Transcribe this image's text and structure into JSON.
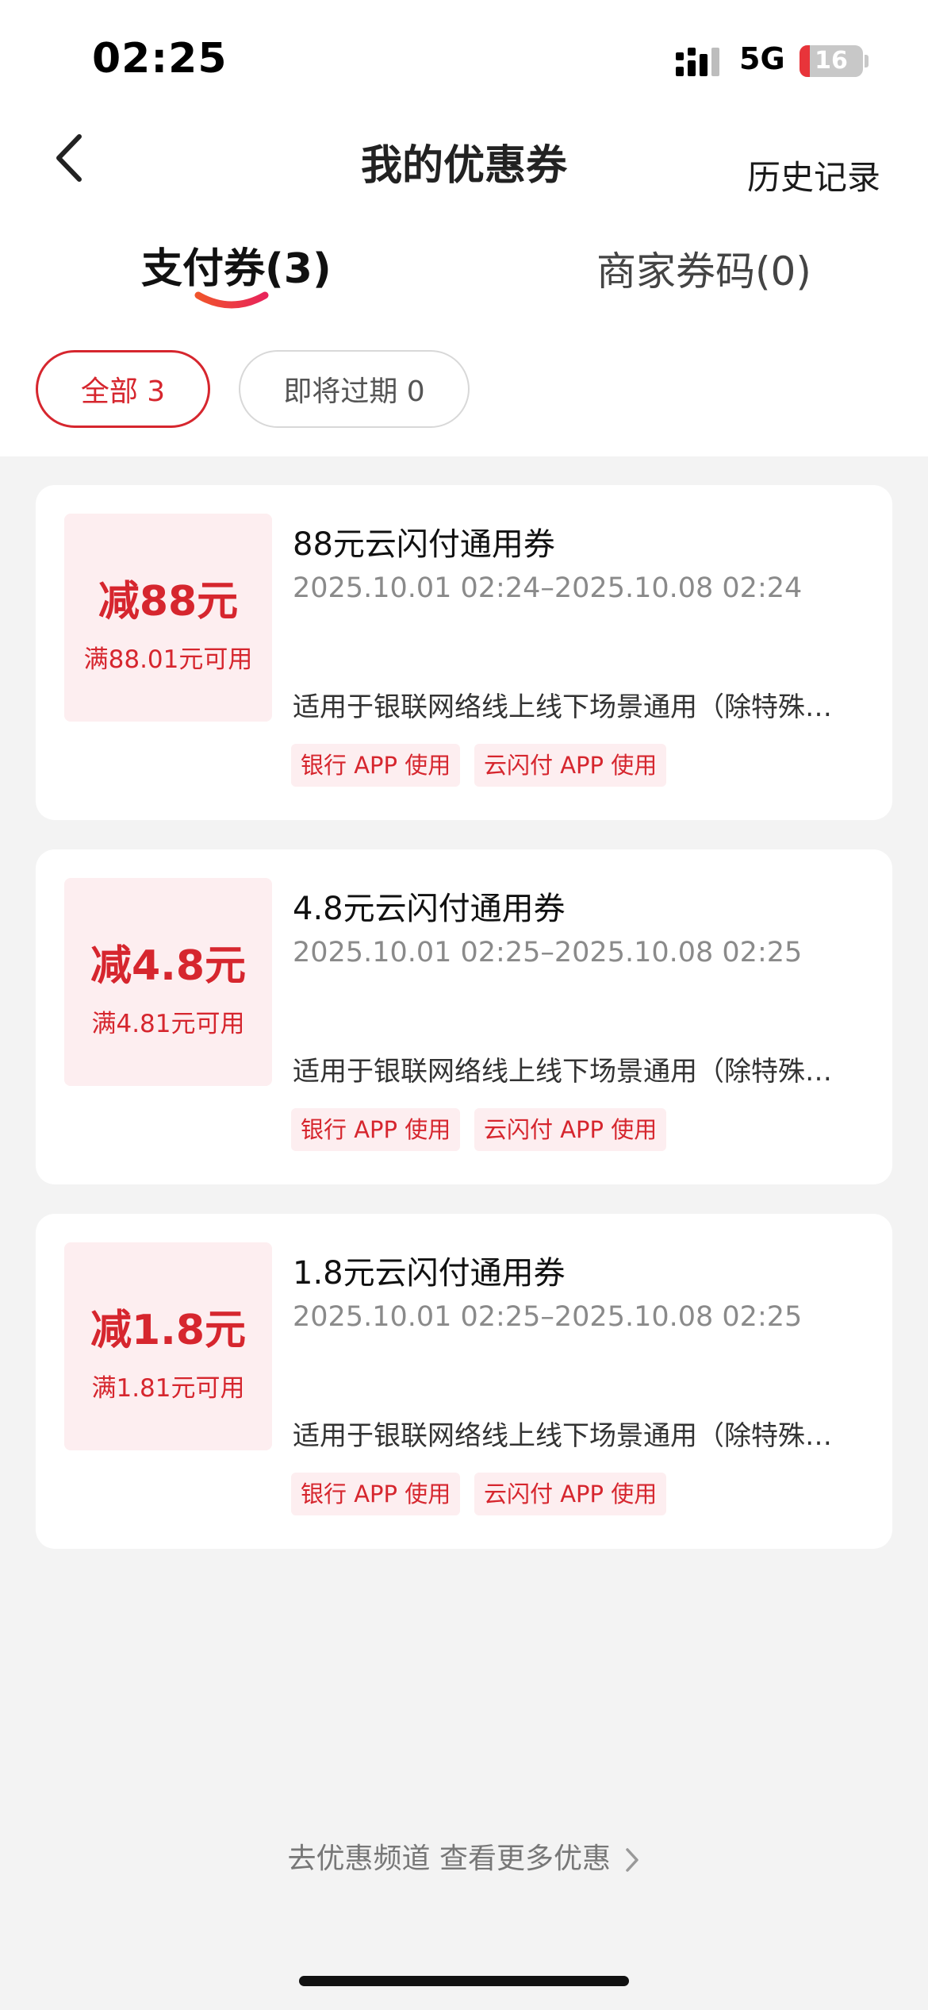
{
  "status_bar": {
    "time": "02:25",
    "network": "5G",
    "battery_level": 16,
    "battery_text": "16"
  },
  "nav": {
    "title": "我的优惠券",
    "history": "历史记录"
  },
  "tabs": [
    {
      "label": "支付券(3)",
      "active": true
    },
    {
      "label": "商家券码(0)",
      "active": false
    }
  ],
  "filters": [
    {
      "label": "全部 3",
      "active": true
    },
    {
      "label": "即将过期 0",
      "active": false
    }
  ],
  "coupons": [
    {
      "amount": "减88元",
      "condition": "满88.01元可用",
      "title": "88元云闪付通用券",
      "period": "2025.10.01 02:24–2025.10.08 02:24",
      "description": "适用于银联网络线上线下场景通用（除特殊…",
      "tags": [
        "银行 APP 使用",
        "云闪付 APP 使用"
      ]
    },
    {
      "amount": "减4.8元",
      "condition": "满4.81元可用",
      "title": "4.8元云闪付通用券",
      "period": "2025.10.01 02:25–2025.10.08 02:25",
      "description": "适用于银联网络线上线下场景通用（除特殊…",
      "tags": [
        "银行 APP 使用",
        "云闪付 APP 使用"
      ]
    },
    {
      "amount": "减1.8元",
      "condition": "满1.81元可用",
      "title": "1.8元云闪付通用券",
      "period": "2025.10.01 02:25–2025.10.08 02:25",
      "description": "适用于银联网络线上线下场景通用（除特殊…",
      "tags": [
        "银行 APP 使用",
        "云闪付 APP 使用"
      ]
    }
  ],
  "footer": {
    "link": "去优惠频道 查看更多优惠"
  },
  "colors": {
    "accent": "#d6262e",
    "coupon_bg": "#fdeef0",
    "page_bg": "#f3f3f3"
  }
}
